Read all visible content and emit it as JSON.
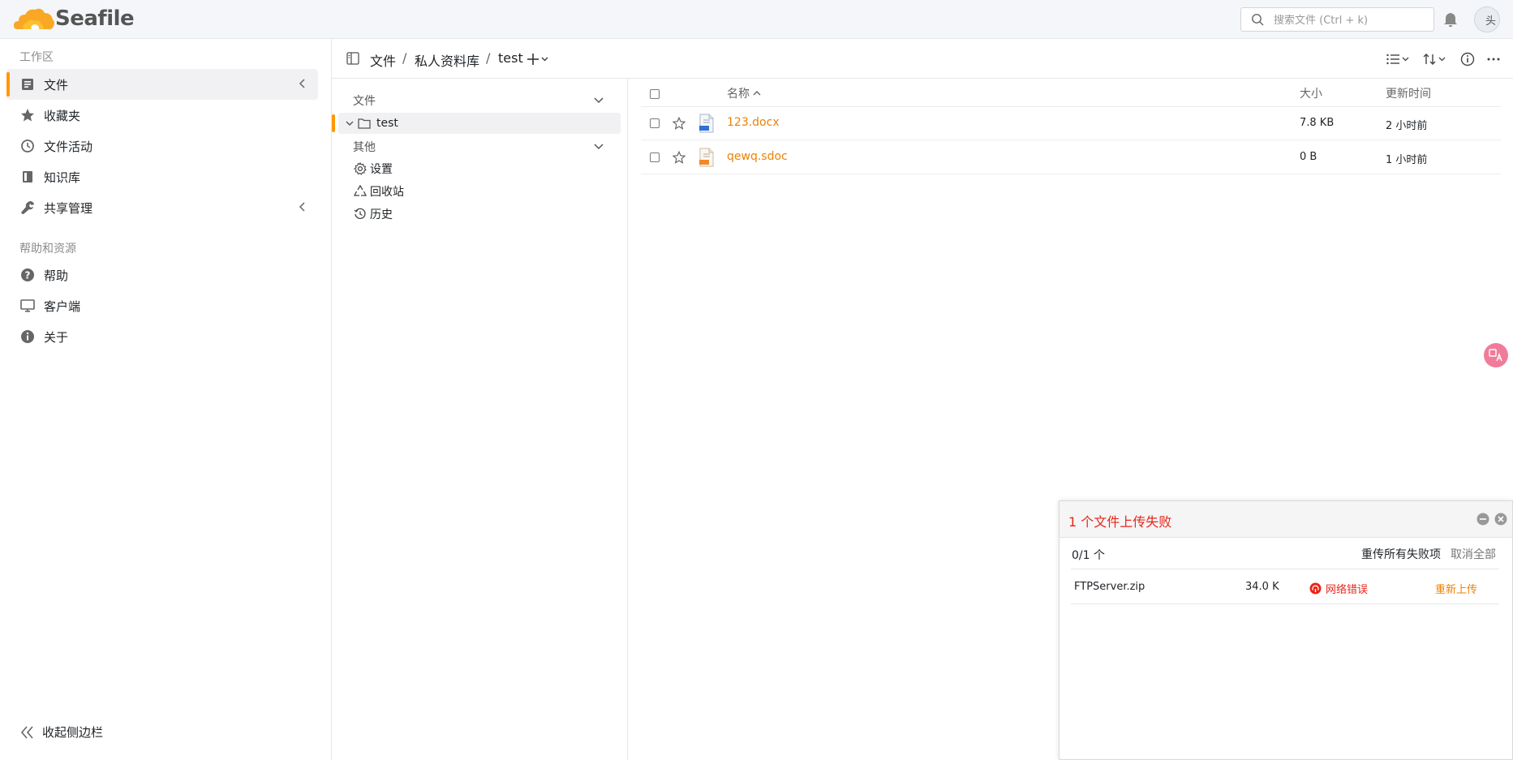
{
  "app": {
    "name": "Seafile"
  },
  "header": {
    "search_placeholder": "搜索文件 (Ctrl + k)",
    "avatar_alt": "头"
  },
  "sidebar": {
    "workspace_heading": "工作区",
    "items": [
      {
        "label": "文件",
        "icon": "file-doc-icon",
        "active": true,
        "has_chevron": true
      },
      {
        "label": "收藏夹",
        "icon": "star-icon"
      },
      {
        "label": "文件活动",
        "icon": "clock-icon"
      },
      {
        "label": "知识库",
        "icon": "book-icon"
      },
      {
        "label": "共享管理",
        "icon": "wrench-icon",
        "has_chevron": true
      }
    ],
    "help_heading": "帮助和资源",
    "help_items": [
      {
        "label": "帮助",
        "icon": "question-icon"
      },
      {
        "label": "客户端",
        "icon": "monitor-icon"
      },
      {
        "label": "关于",
        "icon": "info-icon"
      }
    ],
    "collapse_label": "收起侧边栏"
  },
  "breadcrumb": {
    "items": [
      "文件",
      "私人资料库",
      "test"
    ],
    "separator": "/"
  },
  "tree": {
    "files_heading": "文件",
    "folder": "test",
    "other_heading": "其他",
    "other_items": [
      {
        "label": "设置",
        "icon": "gear-icon"
      },
      {
        "label": "回收站",
        "icon": "recycle-icon"
      },
      {
        "label": "历史",
        "icon": "history-icon"
      }
    ]
  },
  "file_table": {
    "columns": {
      "name": "名称",
      "size": "大小",
      "mtime": "更新时间"
    },
    "rows": [
      {
        "name": "123.docx",
        "size": "7.8 KB",
        "mtime": "2 小时前",
        "type": "docx"
      },
      {
        "name": "qewq.sdoc",
        "size": "0 B",
        "mtime": "1 小时前",
        "type": "sdoc"
      }
    ]
  },
  "upload_dialog": {
    "title": "1 个文件上传失败",
    "count": "0/1 个",
    "retry_all": "重传所有失败项",
    "cancel_all": "取消全部",
    "item": {
      "name": "FTPServer.zip",
      "size": "34.0 K",
      "status": "网络错误",
      "retry": "重新上传"
    }
  },
  "colors": {
    "accent": "#ff9800",
    "link": "#eb8205",
    "error": "#e8251a"
  }
}
